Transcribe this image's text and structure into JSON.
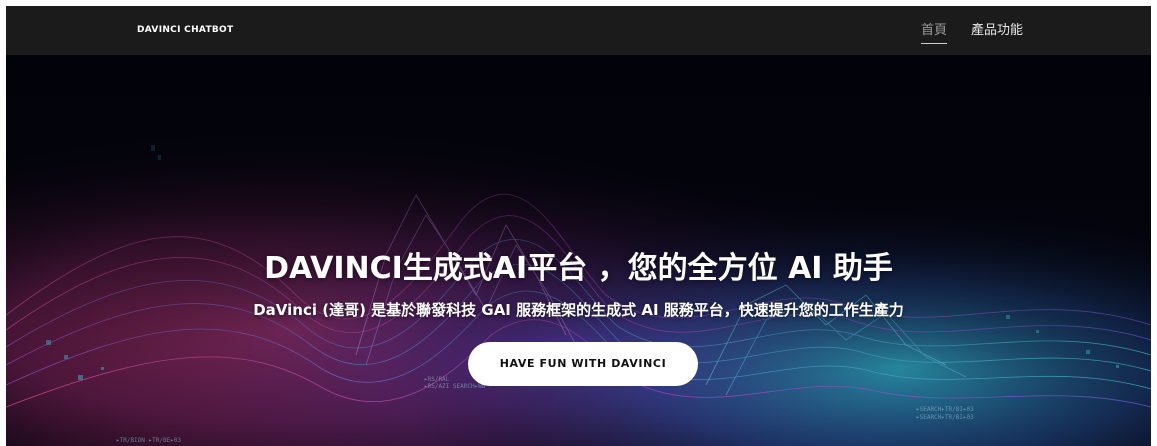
{
  "navbar": {
    "brand": "DAVINCI CHATBOT",
    "links": [
      {
        "label": "首頁",
        "active": true
      },
      {
        "label": "產品功能",
        "active": false
      }
    ]
  },
  "hero": {
    "title_bold_1": "DAVINCI",
    "title_part_2": "生成式",
    "title_bold_3": "AI",
    "title_part_4": "平台 ，您的全方位 ",
    "title_bold_5": "AI",
    "title_part_6": " 助手",
    "subtitle": "DaVinci (達哥) 是基於聯發科技 GAI 服務框架的生成式 AI 服務平台，快速提升您的工作生產力",
    "cta_label": "HAVE FUN WITH DAVINCI",
    "overlay_codes": [
      "▸RS/RAL",
      "▸RS/AZI SEARCH▸WB",
      "▸SEARCH▸TR/BI▸03",
      "▸SEARCH▸TR/BI▸03",
      "▸TR/BION ▸TR/BE▸03"
    ]
  },
  "colors": {
    "navbar_bg": "#1b1b1b",
    "hero_pink": "#e0407e",
    "hero_cyan": "#35c9e0",
    "hero_purple": "#6a3fc8",
    "button_bg": "#ffffff"
  }
}
